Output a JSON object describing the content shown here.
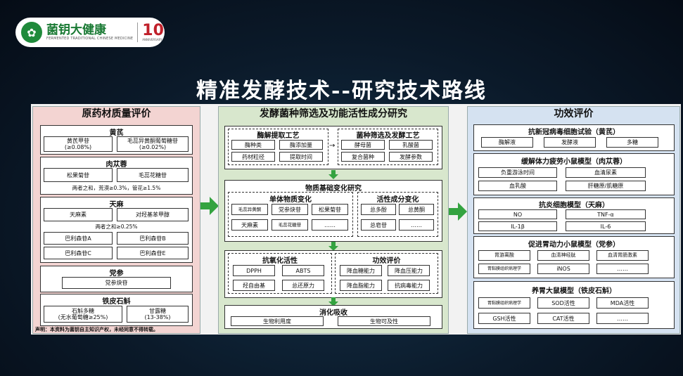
{
  "logo": {
    "brand": "菌钥大健康",
    "sub": "FERMENTED TRADITIONAL CHINESE MEDICINE",
    "ten": "10",
    "anniv": "ANNIVERSARY"
  },
  "title": "精准发酵技术--研究技术路线",
  "col1": {
    "heading": "原药材质量评价",
    "huangqi": {
      "title": "黄芪",
      "a": "黄芪甲苷\n(≥0.08%)",
      "b": "毛蕊异黄酮葡萄糖苷\n(≥0.02%)"
    },
    "roucongrong": {
      "title": "肉苁蓉",
      "a": "松果菊苷",
      "b": "毛蕊花糖苷",
      "note": "两者之和，荒漠≥0.3%，管花≥1.5%"
    },
    "tianma": {
      "title": "天麻",
      "a": "天麻素",
      "b": "对羟基苯甲醇",
      "note": "两者之和≥0.25%",
      "c": "巴利森苷A",
      "d": "巴利森苷B",
      "e": "巴利森苷C",
      "f": "巴利森苷E"
    },
    "dangshen": {
      "title": "党参",
      "a": "党参炔苷"
    },
    "shihu": {
      "title": "铁皮石斛",
      "a": "石斛多糖\n(无水葡萄糖≥25%)",
      "b": "甘露糖\n(13-38%)"
    },
    "declaration": "声明：本资料为菌钥自主知识产权，未经同意不得转载。"
  },
  "col2": {
    "heading": "发酵菌种筛选及功能活性成分研究",
    "enzyme": {
      "title": "酶解提取工艺",
      "items": [
        "酶种类",
        "酶添加量",
        "药材粒径",
        "提取时间"
      ]
    },
    "strain": {
      "title": "菌种筛选及发酵工艺",
      "items": [
        "酵母菌",
        "乳酸菌",
        "复合菌种",
        "发酵参数"
      ]
    },
    "material": {
      "title": "物质基础变化研究",
      "single": {
        "title": "单体物质变化",
        "items": [
          "毛蕊异黄酮",
          "党参炔苷",
          "松果菊苷",
          "天麻素",
          "毛蕊花糖苷",
          "……"
        ]
      },
      "active": {
        "title": "活性成分变化",
        "items": [
          "总多酚",
          "总黄酮",
          "总皂苷",
          "……"
        ]
      }
    },
    "antiox": {
      "title": "抗氧化活性",
      "items": [
        "DPPH",
        "ABTS",
        "羟自由基",
        "总还原力"
      ]
    },
    "efficacy": {
      "title": "功效评价",
      "items": [
        "降血糖能力",
        "降血压能力",
        "降血脂能力",
        "抗病毒能力"
      ]
    },
    "digest": {
      "title": "消化吸收",
      "items": [
        "生物利用度",
        "生物可及性"
      ]
    }
  },
  "col3": {
    "heading": "功效评价",
    "s1": {
      "title": "抗新冠病毒细胞试验（黄芪）",
      "items": [
        "酶解液",
        "发酵液",
        "多糖"
      ]
    },
    "s2": {
      "title": "缓解体力疲劳小鼠模型（肉苁蓉）",
      "items": [
        "负重游泳时间",
        "血清尿素",
        "血乳酸",
        "肝糖原/肌糖原"
      ]
    },
    "s3": {
      "title": "抗炎细胞模型（天麻）",
      "items": [
        "NO",
        "TNF-α",
        "IL-1β",
        "IL-6"
      ]
    },
    "s4": {
      "title": "促进胃动力小鼠模型（党参）",
      "items": [
        "胃游离酸",
        "血清神经肽",
        "血清胃肠激素",
        "胃黏膜组织病理学",
        "iNOS",
        "……"
      ]
    },
    "s5": {
      "title": "养胃大鼠模型（铁皮石斛）",
      "items": [
        "胃黏膜组织病理学",
        "SOD活性",
        "MDA活性",
        "GSH活性",
        "CAT活性",
        "……"
      ]
    }
  }
}
